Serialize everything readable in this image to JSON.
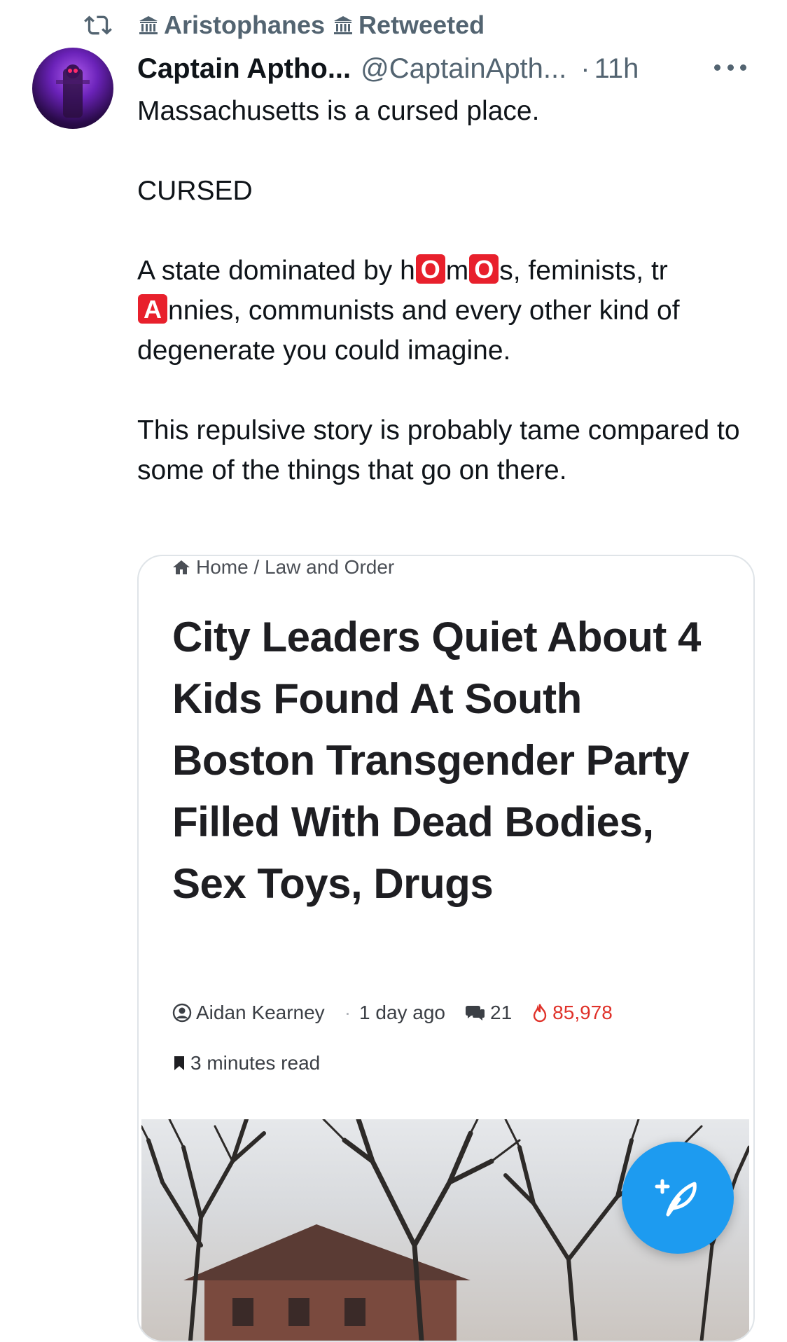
{
  "retweet": {
    "user": "Aristophanes",
    "label": "Retweeted"
  },
  "tweet": {
    "display_name": "Captain Aptho...",
    "handle": "@CaptainApth...",
    "separator": "·",
    "time": "11h",
    "paragraphs": {
      "p1": "Massachusetts is a cursed place.",
      "p2": "CURSED",
      "p3": {
        "a": "A state dominated by h",
        "b": "O",
        "c": "m",
        "d": "O",
        "e": "s, feminists, tr",
        "f": "A",
        "g": "nnies, communists and every other kind of degenerate you could imagine."
      },
      "p4": "This repulsive story is probably tame compared to some of the things that go on there."
    }
  },
  "article": {
    "breadcrumb": "Home / Law and Order",
    "headline": "City Leaders Quiet About 4 Kids Found At South Boston Transgender Party Filled With Dead Bodies, Sex Toys, Drugs",
    "author": "Aidan Kearney",
    "meta_dot": "·",
    "age": "1 day ago",
    "comments": "21",
    "views": "85,978",
    "read_time": "3 minutes read"
  },
  "colors": {
    "accent_blue": "#1d9bf0",
    "emoji_red": "#e8202c",
    "muted_gray": "#536471",
    "views_red": "#e0322a"
  },
  "icons": {
    "retweet": "retweet-icon",
    "institution": "classical-building-icon",
    "more": "more-options-icon",
    "home": "home-icon",
    "author": "user-circle-icon",
    "comments": "speech-bubbles-icon",
    "views": "fire-icon",
    "read_time": "bookmark-icon",
    "compose": "compose-post-icon"
  }
}
